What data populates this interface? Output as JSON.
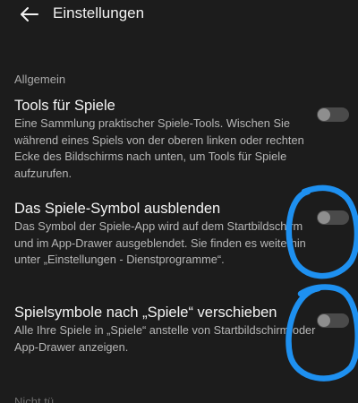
{
  "header": {
    "title": "Einstellungen",
    "back_icon": "arrow-left-icon"
  },
  "section": {
    "label": "Allgemein"
  },
  "settings": [
    {
      "title": "Tools für Spiele",
      "description": "Eine Sammlung praktischer Spiele-Tools. Wischen Sie während eines Spiels von der oberen linken oder rechten Ecke des Bildschirms nach unten, um Tools für Spiele aufzurufen.",
      "enabled": false
    },
    {
      "title": "Das Spiele-Symbol ausblenden",
      "description": "Das Symbol der Spiele-App wird auf dem Startbildschirm und im App-Drawer ausgeblendet. Sie finden es weiterhin unter „Einstellungen - Dienstprogramme“.",
      "enabled": false
    },
    {
      "title": "Spielsymbole nach „Spiele“ verschieben",
      "description": "Alle Ihre Spiele in „Spiele“ anstelle von Startbildschirm oder App-Drawer anzeigen.",
      "enabled": false
    }
  ],
  "next_section": {
    "label": "Nicht tü"
  },
  "colors": {
    "background": "#1c1c1c",
    "annotation": "#1e90f0",
    "toggle_track": "#4a4a4a",
    "toggle_knob": "#8e8e8e"
  }
}
